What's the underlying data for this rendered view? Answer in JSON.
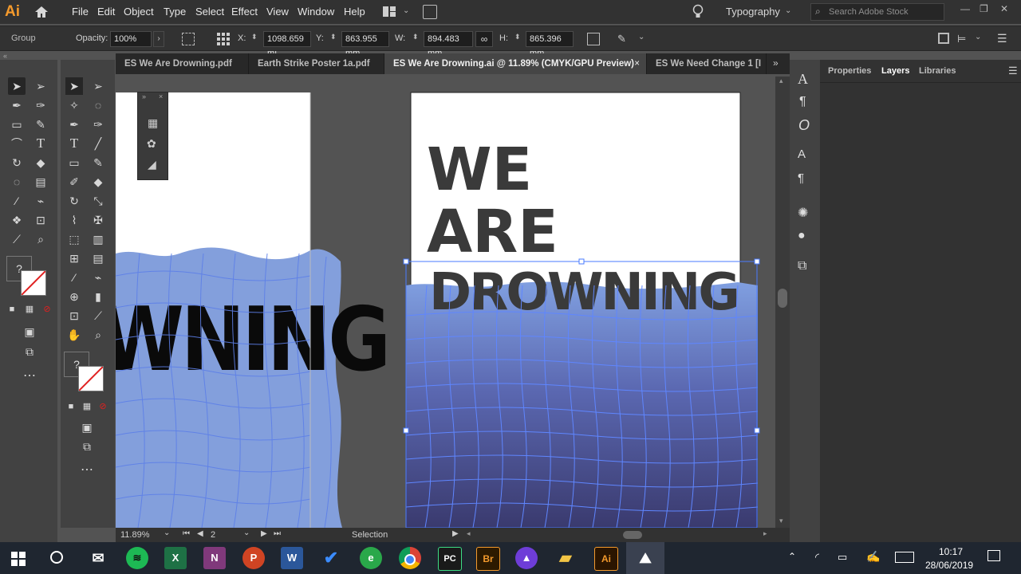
{
  "app": {
    "logo": "Ai"
  },
  "menu": [
    "File",
    "Edit",
    "Object",
    "Type",
    "Select",
    "Effect",
    "View",
    "Window",
    "Help"
  ],
  "workspace": "Typography",
  "search": {
    "placeholder": "Search Adobe Stock"
  },
  "control": {
    "selection_type": "Group",
    "opacity_label": "Opacity:",
    "opacity_value": "100%",
    "x_label": "X:",
    "x_value": "1098.659 mı",
    "y_label": "Y:",
    "y_value": "863.955 mm",
    "w_label": "W:",
    "w_value": "894.483 mm",
    "h_label": "H:",
    "h_value": "865.396 mm"
  },
  "tabs": [
    {
      "label": "ES We Are Drowning.pdf"
    },
    {
      "label": "Earth Strike Poster 1a.pdf"
    },
    {
      "label": "ES We Are Drowning.ai @ 11.89% (CMYK/GPU Preview)",
      "close": "×"
    },
    {
      "label": "ES We Need Change 1 [I"
    }
  ],
  "artwork": {
    "line1": "WE",
    "line2": "ARE",
    "line3": "DROWNING",
    "left_fragment": "WNING"
  },
  "panels": {
    "tabs": [
      "Properties",
      "Layers",
      "Libraries"
    ],
    "active": "Layers"
  },
  "status": {
    "zoom": "11.89%",
    "artboard": "2",
    "tool": "Selection"
  },
  "taskbar": {
    "time": "10:17",
    "date": "28/06/2019",
    "apps": [
      "X",
      "N",
      "P",
      "W",
      "Br",
      "Ai",
      "PC"
    ]
  },
  "colors": {
    "accent": "#f49a2c",
    "selection": "#4a7bff",
    "water_top": "#7f9fe0",
    "water_bottom": "#3b3a6e"
  }
}
